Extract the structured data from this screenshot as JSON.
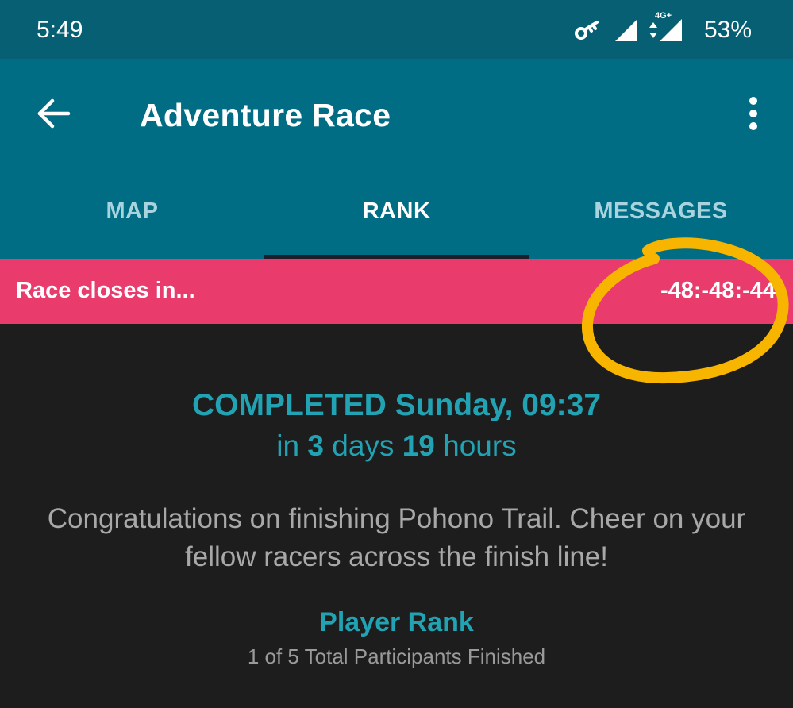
{
  "status_bar": {
    "time": "5:49",
    "network_label": "4G+",
    "battery": "53%",
    "icons": [
      "vpn-key-icon",
      "signal-icon",
      "network-4g-icon"
    ]
  },
  "app_bar": {
    "title": "Adventure Race",
    "back_icon": "arrow-left-icon",
    "menu_icon": "more-vertical-icon"
  },
  "tabs": [
    {
      "label": "MAP",
      "active": false
    },
    {
      "label": "RANK",
      "active": true
    },
    {
      "label": "MESSAGES",
      "active": false
    }
  ],
  "banner": {
    "label": "Race closes in...",
    "countdown": "-48:-48:-44",
    "color": "#e93c6c"
  },
  "annotation": {
    "type": "hand-drawn-circle",
    "color": "#f7b500"
  },
  "summary": {
    "completed": "COMPLETED Sunday, 09:37",
    "duration_prefix": "in",
    "days_value": "3",
    "days_label": "days",
    "hours_value": "19",
    "hours_label": "hours",
    "congrats": "Congratulations on finishing Pohono Trail. Cheer on your fellow racers across the finish line!",
    "rank_title": "Player Rank",
    "rank_detail": "1 of 5 Total Participants Finished"
  },
  "colors": {
    "status_bar": "#075f73",
    "app_bar": "#006d84",
    "background": "#1d1d1d",
    "accent": "#22a3b4"
  }
}
